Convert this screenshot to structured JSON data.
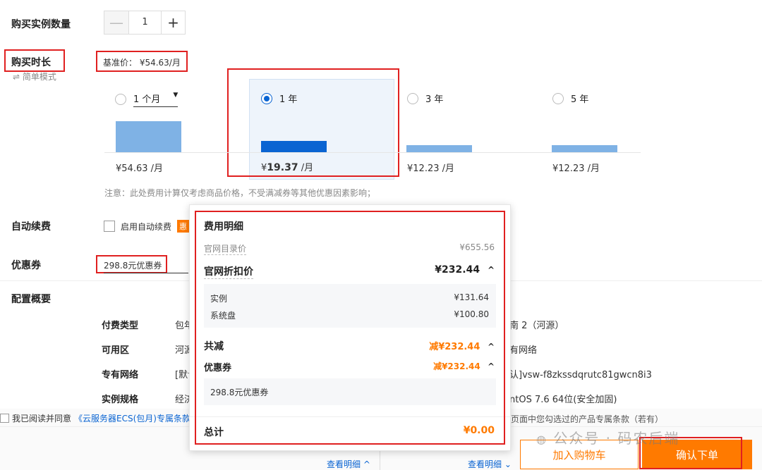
{
  "quantity": {
    "label": "购买实例数量",
    "value": "1",
    "minus": "—",
    "plus": "+"
  },
  "duration": {
    "label": "购买时长",
    "simple_mode": "简单模式",
    "base_price": "基准价： ¥54.63/月",
    "options": [
      {
        "label": "1 个月",
        "price": "¥54.63 /月",
        "selected": false,
        "bar_fraction": 1.0
      },
      {
        "label": "1 年",
        "price_symbol": "¥",
        "price_value": "19.37",
        "price_unit": "/月",
        "selected": true,
        "bar_fraction": 0.355
      },
      {
        "label": "3 年",
        "price": "¥12.23 /月",
        "selected": false,
        "bar_fraction": 0.224
      },
      {
        "label": "5 年",
        "price": "¥12.23 /月",
        "selected": false,
        "bar_fraction": 0.224
      }
    ],
    "dropdown_icon": "caret-down-icon",
    "note": "注意：此处费用计算仅考虑商品价格，不受满减券等其他优惠因素影响；"
  },
  "auto_renew": {
    "label": "自动续费",
    "checkbox_label": "启用自动续费",
    "badge": "惠"
  },
  "coupon": {
    "label": "优惠券",
    "value": "298.8元优惠券"
  },
  "config": {
    "label": "配置概要",
    "rows": [
      {
        "key": "付费类型",
        "val": "包年",
        "right": "南 2（河源）"
      },
      {
        "key": "可用区",
        "val": "河源",
        "right": "有网络"
      },
      {
        "key": "专有网络",
        "val": "[默认",
        "right": "认]vsw-f8zkssdqrutc81gwcn8i3"
      },
      {
        "key": "实例规格",
        "val": "经济",
        "right": "ntOS 7.6 64位(安全加固)"
      }
    ]
  },
  "popup": {
    "title": "费用明细",
    "list_price_label": "官网目录价",
    "list_price": "¥655.56",
    "discount_label": "官网折扣价",
    "discount_value": "¥232.44",
    "items": [
      {
        "name": "实例",
        "price": "¥131.64"
      },
      {
        "name": "系统盘",
        "price": "¥100.80"
      }
    ],
    "total_reduce_label": "共减",
    "total_reduce_value": "减¥232.44",
    "coupon_label": "优惠券",
    "coupon_value": "减¥232.44",
    "coupon_item": "298.8元优惠券",
    "total_label": "总计",
    "total_value": "¥0.00"
  },
  "agreement": {
    "prefix": "我已阅读并同意",
    "link": "《云服务器ECS(包月)专属条款",
    "suffix": "页面中您勾选过的产品专属条款（若有）"
  },
  "footer": {
    "view_detail_1": "查看明细",
    "view_detail_2": "查看明细",
    "add_cart": "加入购物车",
    "confirm": "确认下单",
    "watermark": "公众号 · 码农后端"
  },
  "colors": {
    "accent": "#ff7a00",
    "primary": "#0a64d2",
    "bar": "#7fb2e5",
    "highlight": "#e02020"
  }
}
